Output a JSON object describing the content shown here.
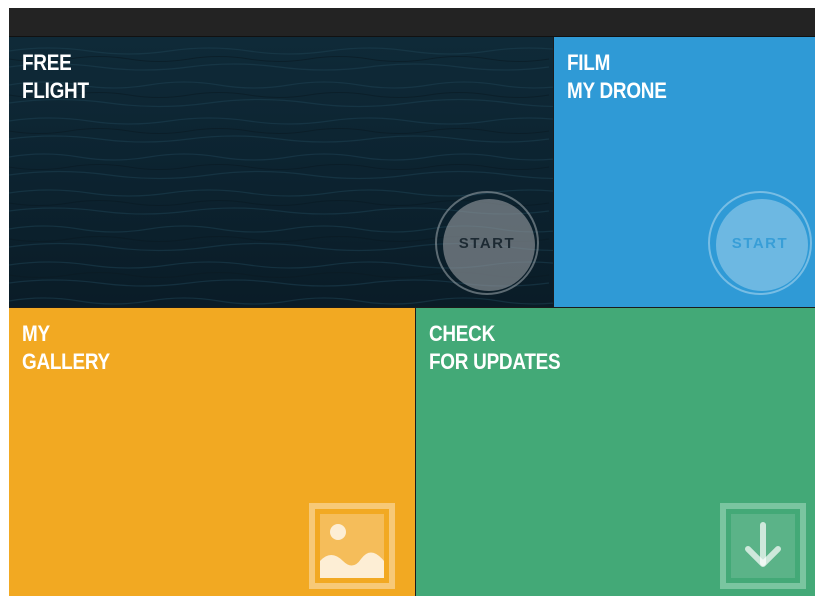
{
  "tiles": {
    "free_flight": {
      "title_line1": "FREE",
      "title_line2": "FLIGHT",
      "button_label": "START",
      "color": "#0d2230"
    },
    "film_my_drone": {
      "title_line1": "FILM",
      "title_line2": "MY DRONE",
      "button_label": "START",
      "color": "#2f9ad6"
    },
    "my_gallery": {
      "title_line1": "MY",
      "title_line2": "GALLERY",
      "icon": "image-icon",
      "color": "#f2a922"
    },
    "check_for_updates": {
      "title_line1": "CHECK",
      "title_line2": "FOR UPDATES",
      "icon": "download-icon",
      "color": "#43a977"
    }
  }
}
